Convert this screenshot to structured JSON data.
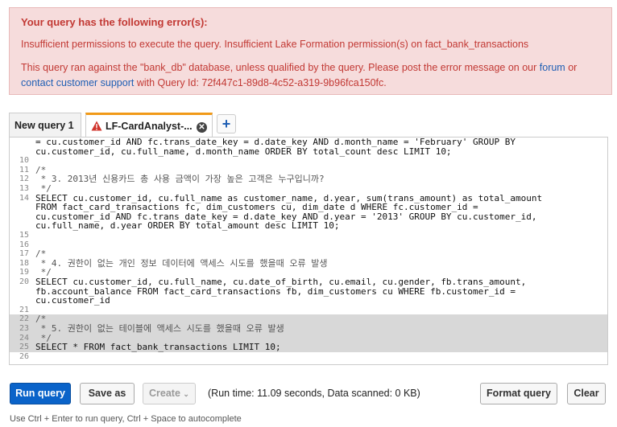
{
  "error": {
    "title": "Your query has the following error(s):",
    "message": "Insufficient permissions to execute the query. Insufficient Lake Formation permission(s) on fact_bank_transactions",
    "note_prefix": "This query ran against the \"bank_db\" database, unless qualified by the query. Please post the error message on our ",
    "forum_link": "forum",
    "note_or": " or",
    "support_link": "contact customer support",
    "query_id_text": " with Query Id: 72f447c1-89d8-4c52-a319-9b96fca150fc."
  },
  "tabs": {
    "tab1_label": "New query 1",
    "tab2_label": "LF-CardAnalyst-...",
    "add_label": "+"
  },
  "editor": {
    "lines": [
      {
        "n": "",
        "text": "= cu.customer_id AND fc.trans_date_key = d.date_key AND d.month_name = 'February' GROUP BY"
      },
      {
        "n": "",
        "text": "cu.customer_id, cu.full_name, d.month_name ORDER BY total_count desc LIMIT 10;"
      },
      {
        "n": "10",
        "text": ""
      },
      {
        "n": "11",
        "text": "/*"
      },
      {
        "n": "12",
        "text": " * 3. 2013년 신용카드 총 사용 금액이 가장 높은 고객은 누구입니까?"
      },
      {
        "n": "13",
        "text": " */"
      },
      {
        "n": "14",
        "text": "SELECT cu.customer_id, cu.full_name as customer_name, d.year, sum(trans_amount) as total_amount"
      },
      {
        "n": "",
        "text": "FROM fact_card_transactions fc, dim_customers cu, dim_date d WHERE fc.customer_id ="
      },
      {
        "n": "",
        "text": "cu.customer_id AND fc.trans_date_key = d.date_key AND d.year = '2013' GROUP BY cu.customer_id,"
      },
      {
        "n": "",
        "text": "cu.full_name, d.year ORDER BY total_amount desc LIMIT 10;"
      },
      {
        "n": "15",
        "text": ""
      },
      {
        "n": "16",
        "text": ""
      },
      {
        "n": "17",
        "text": "/*"
      },
      {
        "n": "18",
        "text": " * 4. 권한이 없는 개인 정보 데이터에 액세스 시도를 했을때 오류 발생"
      },
      {
        "n": "19",
        "text": " */"
      },
      {
        "n": "20",
        "text": "SELECT cu.customer_id, cu.full_name, cu.date_of_birth, cu.email, cu.gender, fb.trans_amount,"
      },
      {
        "n": "",
        "text": "fb.account_balance FROM fact_card_transactions fb, dim_customers cu WHERE fb.customer_id ="
      },
      {
        "n": "",
        "text": "cu.customer_id"
      },
      {
        "n": "21",
        "text": ""
      },
      {
        "n": "22",
        "text": "/*"
      },
      {
        "n": "23",
        "text": " * 5. 권한이 없는 테이블에 액세스 시도를 했을때 오류 발생"
      },
      {
        "n": "24",
        "text": " */"
      },
      {
        "n": "25",
        "text": "SELECT * FROM fact_bank_transactions LIMIT 10;"
      },
      {
        "n": "26",
        "text": ""
      }
    ]
  },
  "toolbar": {
    "run_label": "Run query",
    "save_label": "Save as",
    "create_label": "Create",
    "run_info": "(Run time: 11.09 seconds, Data scanned: 0 KB)",
    "format_label": "Format query",
    "clear_label": "Clear"
  },
  "hint": "Use Ctrl + Enter to run query, Ctrl + Space to autocomplete"
}
